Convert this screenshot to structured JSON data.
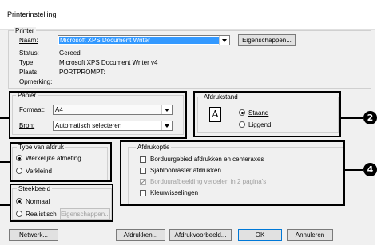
{
  "window": {
    "title": "Printerinstelling"
  },
  "printer": {
    "legend": "Printer",
    "name_label": "Naam:",
    "name_value": "Microsoft XPS Document Writer",
    "properties_button": "Eigenschappen...",
    "status_label": "Status:",
    "status_value": "Gereed",
    "type_label": "Type:",
    "type_value": "Microsoft XPS Document Writer v4",
    "place_label": "Plaats:",
    "place_value": "PORTPROMPT:",
    "comment_label": "Opmerking:"
  },
  "paper": {
    "legend": "Papier",
    "format_label": "Formaat:",
    "format_value": "A4",
    "source_label": "Bron:",
    "source_value": "Automatisch selecteren"
  },
  "orientation": {
    "legend": "Afdrukstand",
    "icon_letter": "A",
    "portrait": "Staand",
    "landscape": "Liggend",
    "selected": "portrait"
  },
  "print_type": {
    "legend": "Type van afdruk",
    "actual": "Werkelijke afmeting",
    "reduced": "Verkleind",
    "selected": "actual"
  },
  "print_options": {
    "legend": "Afdrukoptie",
    "items": [
      {
        "label": "Borduurgebied afdrukken en centeraxes",
        "checked": false,
        "disabled": false
      },
      {
        "label": "Sjabloonraster afdrukken",
        "checked": false,
        "disabled": false
      },
      {
        "label": "Borduurafbeelding verdelen in 2 pagina's",
        "checked": true,
        "disabled": true
      },
      {
        "label": "Kleurwisselingen",
        "checked": false,
        "disabled": false
      }
    ]
  },
  "stitch_image": {
    "legend": "Steekbeeld",
    "normal": "Normaal",
    "realistic": "Realistisch",
    "properties_button": "Eigenschappen...",
    "selected": "normal"
  },
  "buttons": {
    "network": "Netwerk...",
    "print": "Afdrukken...",
    "preview": "Afdrukvoorbeeld...",
    "ok": "OK",
    "cancel": "Annuleren"
  },
  "callouts": {
    "badge_2": "2",
    "badge_4": "4"
  }
}
